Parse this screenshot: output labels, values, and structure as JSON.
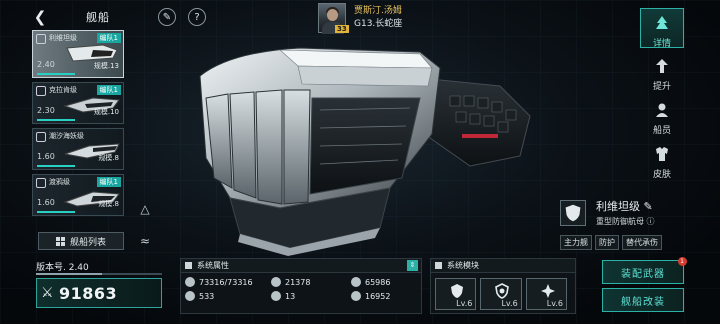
{
  "topbar": {
    "back_icon": "chevron-left-icon",
    "title": "舰船",
    "edit_icon": "pen-icon",
    "help_icon": "question-icon"
  },
  "commander": {
    "name": "贾斯汀.汤姆",
    "level": "33",
    "location": "G13.长蛇座"
  },
  "fleet": [
    {
      "name": "利维坦级",
      "team": "编队1",
      "version": "2.40",
      "scale": "规模.13",
      "selected": true
    },
    {
      "name": "克拉肯级",
      "team": "编队1",
      "version": "2.30",
      "scale": "规模.10",
      "selected": false
    },
    {
      "name": "潮汐海妖级",
      "team": "",
      "version": "1.60",
      "scale": "规模.8",
      "selected": false
    },
    {
      "name": "渡鸦级",
      "team": "编队1",
      "version": "1.60",
      "scale": "规模.8",
      "selected": false
    }
  ],
  "fleet_list_button": "舰船列表",
  "right_nav": [
    {
      "label": "详情",
      "icon": "tree-icon",
      "active": true
    },
    {
      "label": "提升",
      "icon": "upgrade-icon",
      "active": false
    },
    {
      "label": "船员",
      "icon": "crew-icon",
      "active": false
    },
    {
      "label": "皮肤",
      "icon": "skin-icon",
      "active": false
    }
  ],
  "ship": {
    "name": "利维坦级",
    "class": "重型防御航母",
    "tags": [
      "主力舰",
      "防护",
      "替代承伤"
    ]
  },
  "version": {
    "label": "版本号. 2.40",
    "progress": 0.52
  },
  "power": {
    "value": "91863"
  },
  "attributes": {
    "title": "系统属性",
    "items": [
      {
        "icon": "hull-icon",
        "value": "73316/73316"
      },
      {
        "icon": "armor-icon",
        "value": "21378"
      },
      {
        "icon": "shield-icon",
        "value": "65986"
      },
      {
        "icon": "speed-icon",
        "value": "533"
      },
      {
        "icon": "energy-icon",
        "value": "13"
      },
      {
        "icon": "attack-icon",
        "value": "16952"
      }
    ]
  },
  "modules": {
    "title": "系统模块",
    "items": [
      {
        "icon": "module-shield-icon",
        "level": "Lv.6"
      },
      {
        "icon": "module-defense-icon",
        "level": "Lv.6"
      },
      {
        "icon": "module-cross-icon",
        "level": "Lv.6"
      }
    ]
  },
  "buttons": {
    "weapons": "装配武器",
    "weapons_badge": "1",
    "refit": "舰船改装"
  },
  "colors": {
    "accent": "#2bb1a6",
    "commander_name": "#e8c25a",
    "badge": "#d63b2f"
  }
}
